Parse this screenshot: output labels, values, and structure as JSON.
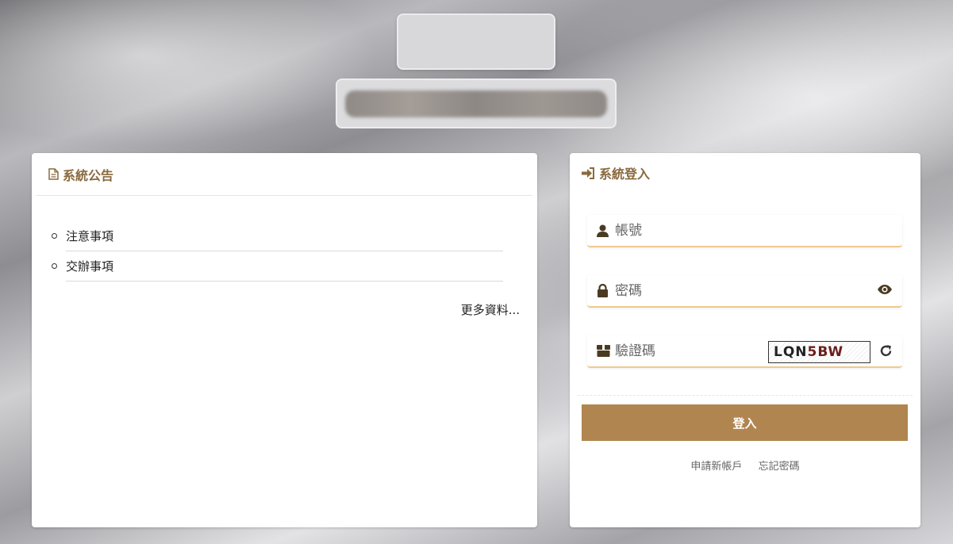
{
  "announcement": {
    "title": "系統公告",
    "items": [
      "注意事項",
      "交辦事項"
    ],
    "more_label": "更多資料..."
  },
  "login": {
    "title": "系統登入",
    "username_placeholder": "帳號",
    "password_placeholder": "密碼",
    "captcha_placeholder": "驗證碼",
    "captcha_text_a": "LQN",
    "captcha_text_b": "5BW",
    "submit_label": "登入",
    "register_label": "申請新帳戶",
    "forgot_label": "忘記密碼"
  },
  "colors": {
    "accent": "#8a6a3e",
    "button": "#b08550",
    "field_border": "#f0c98e"
  }
}
